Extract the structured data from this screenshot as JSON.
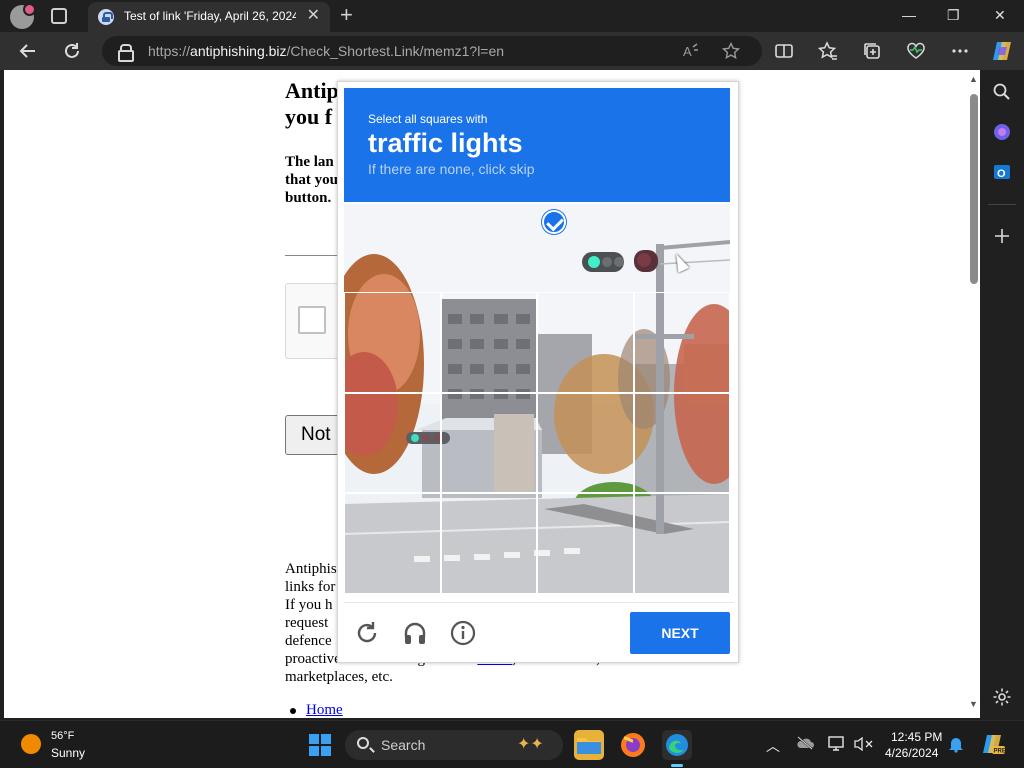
{
  "browser": {
    "tab_title": "Test of link 'Friday, April 26, 2024",
    "tab_close": "✕",
    "new_tab": "+",
    "url_prefix": "https://",
    "url_host": "antiphishing.biz",
    "url_path": "/Check_Shortest.Link/memz1?l=en",
    "read_aloud": "A̅",
    "window_minimize": "—",
    "window_restore": "❐",
    "window_close": "✕"
  },
  "page": {
    "title": "Antip you f",
    "lead": "The lan that you button.",
    "button_label": "Not",
    "paragraph_lines": [
      "Antiphis",
      "links for",
      "If you h",
      "request",
      "defence",
      "proactive threat intelligence for",
      "marketplaces, etc."
    ],
    "paragraph_link": "banks",
    "paragraph_tail": ", online stores,",
    "home_link": "Home"
  },
  "captcha": {
    "instruction": "Select all squares with",
    "target": "traffic lights",
    "hint": "If there are none, click skip",
    "next_label": "NEXT",
    "grid": {
      "rows": 3,
      "cols": 4
    },
    "header_color": "#1a73e8"
  },
  "taskbar": {
    "temperature": "56°F",
    "weather": "Sunny",
    "search_placeholder": "Search",
    "time": "12:45 PM",
    "date": "4/26/2024"
  },
  "icons": {
    "back": "back-icon",
    "refresh": "refresh-icon",
    "favorite": "star-icon",
    "split": "split-screen-icon",
    "favorites": "favorites-icon",
    "collections": "collections-icon",
    "performance": "heartbeat-icon",
    "more": "more-icon",
    "copilot": "copilot-icon"
  }
}
